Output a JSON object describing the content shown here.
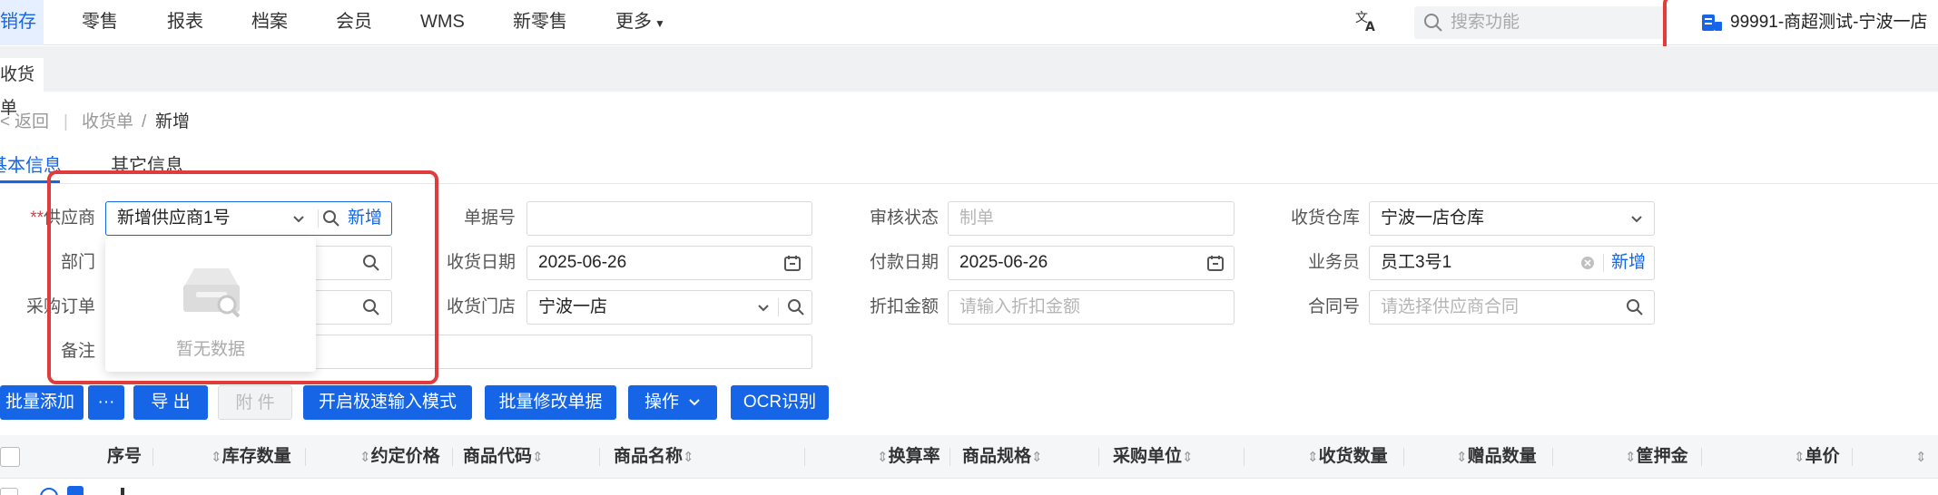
{
  "topnav": {
    "items": [
      {
        "label": "销存",
        "active": true
      },
      {
        "label": "零售",
        "active": false
      },
      {
        "label": "报表",
        "active": false
      },
      {
        "label": "档案",
        "active": false
      },
      {
        "label": "会员",
        "active": false
      },
      {
        "label": "WMS",
        "active": false
      },
      {
        "label": "新零售",
        "active": false
      },
      {
        "label": "更多",
        "active": false
      }
    ],
    "search_placeholder": "搜索功能",
    "store": "99991-商超测试-宁波一店"
  },
  "page_tab": "收货单",
  "breadcrumb": {
    "back": "返回",
    "parent": "收货单",
    "separator": "/",
    "current": "新增"
  },
  "subtabs": [
    "基本信息",
    "其它信息"
  ],
  "form": {
    "supplier": {
      "label": "供应商",
      "value": "新增供应商1号",
      "add": "新增"
    },
    "department": {
      "label": "部门"
    },
    "purchase_order": {
      "label": "采购订单"
    },
    "remark": {
      "label": "备注"
    },
    "doc_no": {
      "label": "单据号"
    },
    "receive_date": {
      "label": "收货日期",
      "value": "2025-06-26"
    },
    "receive_store": {
      "label": "收货门店",
      "value": "宁波一店"
    },
    "audit_status": {
      "label": "审核状态",
      "placeholder": "制单"
    },
    "pay_date": {
      "label": "付款日期",
      "value": "2025-06-26"
    },
    "discount": {
      "label": "折扣金额",
      "placeholder": "请输入折扣金额"
    },
    "warehouse": {
      "label": "收货仓库",
      "value": "宁波一店仓库"
    },
    "salesman": {
      "label": "业务员",
      "value": "员工3号1",
      "add": "新增"
    },
    "contract": {
      "label": "合同号",
      "placeholder": "请选择供应商合同"
    }
  },
  "dropdown": {
    "empty_text": "暂无数据"
  },
  "toolbar": {
    "batch_add": "批量添加",
    "more": "···",
    "export": "导 出",
    "attachment": "附 件",
    "fast_input": "开启极速输入模式",
    "batch_edit": "批量修改单据",
    "operation": "操作",
    "ocr": "OCR识别"
  },
  "table": {
    "columns": [
      "序号",
      "库存数量",
      "约定价格",
      "商品代码",
      "商品名称",
      "换算率",
      "商品规格",
      "采购单位",
      "收货数量",
      "赠品数量",
      "筐押金",
      "单价"
    ]
  },
  "colors": {
    "primary": "#1565e6",
    "highlight": "#e03c3c"
  }
}
